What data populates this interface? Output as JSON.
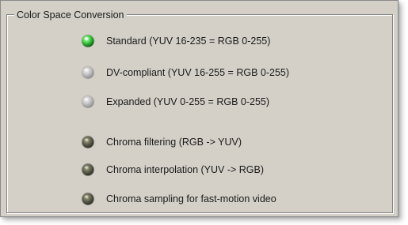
{
  "group": {
    "title": "Color Space Conversion"
  },
  "options": [
    {
      "label": "Standard (YUV 16-235 = RGB 0-255)",
      "state": "selected",
      "color": "#3cc83c"
    },
    {
      "label": "DV-compliant (YUV 16-255 = RGB 0-255)",
      "state": "disabled",
      "color": "#b8b8b8"
    },
    {
      "label": "Expanded (YUV 0-255 = RGB 0-255)",
      "state": "disabled",
      "color": "#b8b8b8"
    },
    {
      "label": "Chroma filtering (RGB -> YUV)",
      "state": "off",
      "color": "#6b6b55"
    },
    {
      "label": "Chroma interpolation (YUV -> RGB)",
      "state": "off",
      "color": "#6b6b55"
    },
    {
      "label": "Chroma sampling for fast-motion video",
      "state": "off",
      "color": "#6b6b55"
    }
  ]
}
